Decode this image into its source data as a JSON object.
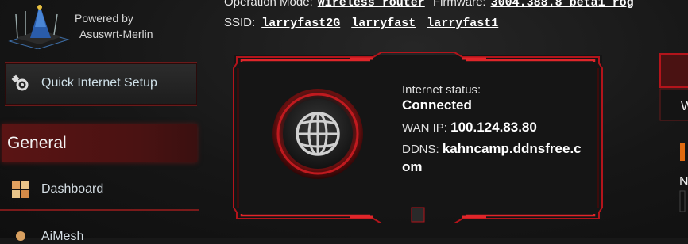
{
  "header": {
    "powered_line1": "Powered by",
    "powered_line2": "Asuswrt-Merlin",
    "opmode_label": "Operation Mode:",
    "opmode_value": "Wireless router",
    "firmware_label": "Firmware:",
    "firmware_value": "3004.388.8_beta1_rog",
    "ssid_label": "SSID:",
    "ssids": [
      "larryfast2G",
      "larryfast",
      "larryfast1"
    ]
  },
  "sidebar": {
    "quick_setup": "Quick Internet Setup",
    "section": "General",
    "items": [
      {
        "label": "Dashboard",
        "icon": "dashboard-icon"
      },
      {
        "label": "AiMesh",
        "icon": "aimesh-icon"
      }
    ]
  },
  "status": {
    "internet_label": "Internet status:",
    "internet_value": "Connected",
    "wan_label": "WAN IP:",
    "wan_value": "100.124.83.80",
    "ddns_label": "DDNS:",
    "ddns_value": "kahncamp.ddnsfree.com",
    "icon": "globe-icon"
  },
  "right_panel": {
    "letters": [
      "W",
      "N"
    ]
  },
  "colors": {
    "accent_red": "#b3141b",
    "dark_red": "#6a1a1a",
    "background": "#181818"
  }
}
